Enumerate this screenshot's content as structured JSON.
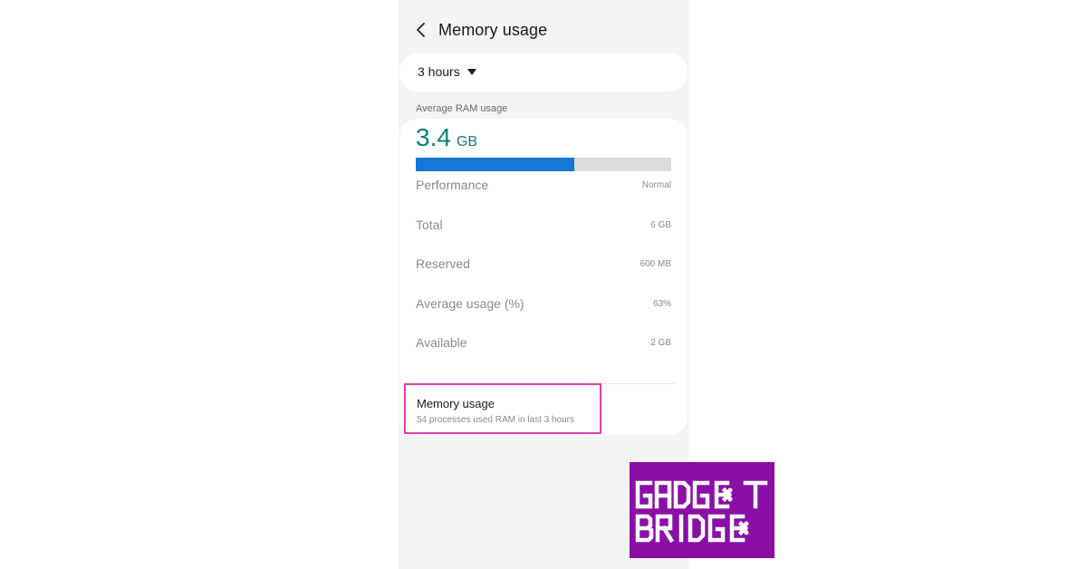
{
  "header": {
    "title": "Memory usage",
    "back_icon": "chevron-left-icon"
  },
  "period": {
    "selected": "3 hours"
  },
  "summary": {
    "label": "Average RAM usage",
    "value": "3.4",
    "unit": "GB",
    "usage_fraction": 0.62,
    "bar_color": "#1777d7",
    "value_color": "#0d7f7a"
  },
  "stats": [
    {
      "label": "Performance",
      "value": "Normal"
    },
    {
      "label": "Total",
      "value": "6 GB"
    },
    {
      "label": "Reserved",
      "value": "600 MB"
    },
    {
      "label": "Average usage (%)",
      "value": "63%"
    },
    {
      "label": "Available",
      "value": "2 GB"
    }
  ],
  "memory_usage_item": {
    "title": "Memory usage",
    "subtitle": "54 processes used RAM in last 3 hours",
    "highlight_color": "#e040b4"
  },
  "logo": {
    "text_line1": "GADGET",
    "text_line2": "BRIDGE",
    "background": "#8b0fa6"
  }
}
